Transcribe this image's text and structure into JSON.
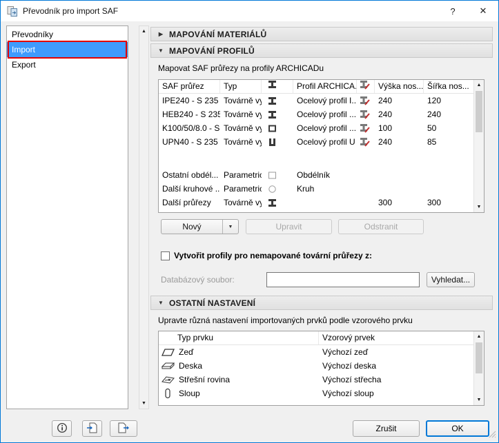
{
  "window": {
    "title": "Převodník pro import SAF",
    "help": "?",
    "close": "✕",
    "app_icon": "translator-icon"
  },
  "icons": {
    "up_arrow": "▲",
    "down_arrow": "▼",
    "dropdown_arrow": "▼",
    "collapsed_arrow": "▶",
    "expanded_arrow": "▼"
  },
  "colors": {
    "selection": "#3f9bfd",
    "annotation": "#e60000",
    "window_border": "#0078d7",
    "default_button_border": "#0078d7"
  },
  "sidebar": {
    "items": [
      {
        "label": "Převodníky",
        "selected": false
      },
      {
        "label": "Import",
        "selected": true
      },
      {
        "label": "Export",
        "selected": false
      }
    ]
  },
  "panel": {
    "sections": [
      {
        "title": "MAPOVÁNÍ MATERIÁLŮ",
        "collapsed": true
      },
      {
        "title": "MAPOVÁNÍ PROFILŮ",
        "collapsed": false
      },
      {
        "title": "OSTATNÍ NASTAVENÍ",
        "collapsed": false
      }
    ],
    "profiles": {
      "description": "Mapovat SAF průřezy na profily ARCHICADu",
      "table": {
        "headers": {
          "saf": "SAF průřez",
          "typ": "Typ",
          "shape_icon": "section-shape-icon",
          "profil": "Profil ARCHICA...",
          "profil_icon": "profile-edit-icon",
          "vyska": "Výška nos...",
          "sirka": "Šířka nos..."
        },
        "rows": [
          {
            "saf": "IPE240 - S 235",
            "typ": "Továrně vy...",
            "shape": "ibeam",
            "profil": "Ocelový profil I...",
            "has_profile_icon": true,
            "vyska": "240",
            "sirka": "120"
          },
          {
            "saf": "HEB240 - S 235",
            "typ": "Továrně vy...",
            "shape": "ibeam",
            "profil": "Ocelový profil ...",
            "has_profile_icon": true,
            "vyska": "240",
            "sirka": "240"
          },
          {
            "saf": "K100/50/8.0 - S...",
            "typ": "Továrně vy...",
            "shape": "box",
            "profil": "Ocelový profil ...",
            "has_profile_icon": true,
            "vyska": "100",
            "sirka": "50"
          },
          {
            "saf": "UPN40 - S 235",
            "typ": "Továrně vy...",
            "shape": "ubeam",
            "profil": "Ocelový profil U",
            "has_profile_icon": true,
            "vyska": "240",
            "sirka": "85"
          },
          {
            "saf": "Ostatní obdél...",
            "typ": "Parametric...",
            "shape": "rect",
            "profil": "Obdélník",
            "has_profile_icon": false,
            "vyska": "",
            "sirka": ""
          },
          {
            "saf": "Další kruhové ...",
            "typ": "Parametric...",
            "shape": "circle",
            "profil": "Kruh",
            "has_profile_icon": false,
            "vyska": "",
            "sirka": ""
          },
          {
            "saf": "Další průřezy",
            "typ": "Továrně vy...",
            "shape": "ibeam",
            "profil": "",
            "has_profile_icon": false,
            "vyska": "300",
            "sirka": "300"
          }
        ]
      },
      "buttons": {
        "new": "Nový",
        "edit": "Upravit",
        "remove": "Odstranit"
      },
      "create_checkbox": {
        "label": "Vytvořit profily pro nemapované tovární průřezy z:",
        "checked": false
      },
      "database": {
        "label": "Databázový soubor:",
        "value": "",
        "browse": "Vyhledat..."
      }
    },
    "other": {
      "description": "Upravte různá nastavení importovaných prvků podle vzorového prvku",
      "table": {
        "headers": {
          "typ": "Typ prvku",
          "vzor": "Vzorový prvek"
        },
        "rows": [
          {
            "icon": "wall-icon",
            "typ": "Zeď",
            "vzor": "Výchozí zeď"
          },
          {
            "icon": "slab-icon",
            "typ": "Deska",
            "vzor": "Výchozí deska"
          },
          {
            "icon": "roof-plane-icon",
            "typ": "Střešní rovina",
            "vzor": "Výchozí střecha"
          },
          {
            "icon": "column-icon",
            "typ": "Sloup",
            "vzor": "Výchozí sloup"
          }
        ]
      }
    }
  },
  "footer": {
    "cancel": "Zrušit",
    "ok": "OK",
    "tool_icons": [
      "info-icon",
      "open-translator-icon",
      "save-translator-icon"
    ]
  }
}
